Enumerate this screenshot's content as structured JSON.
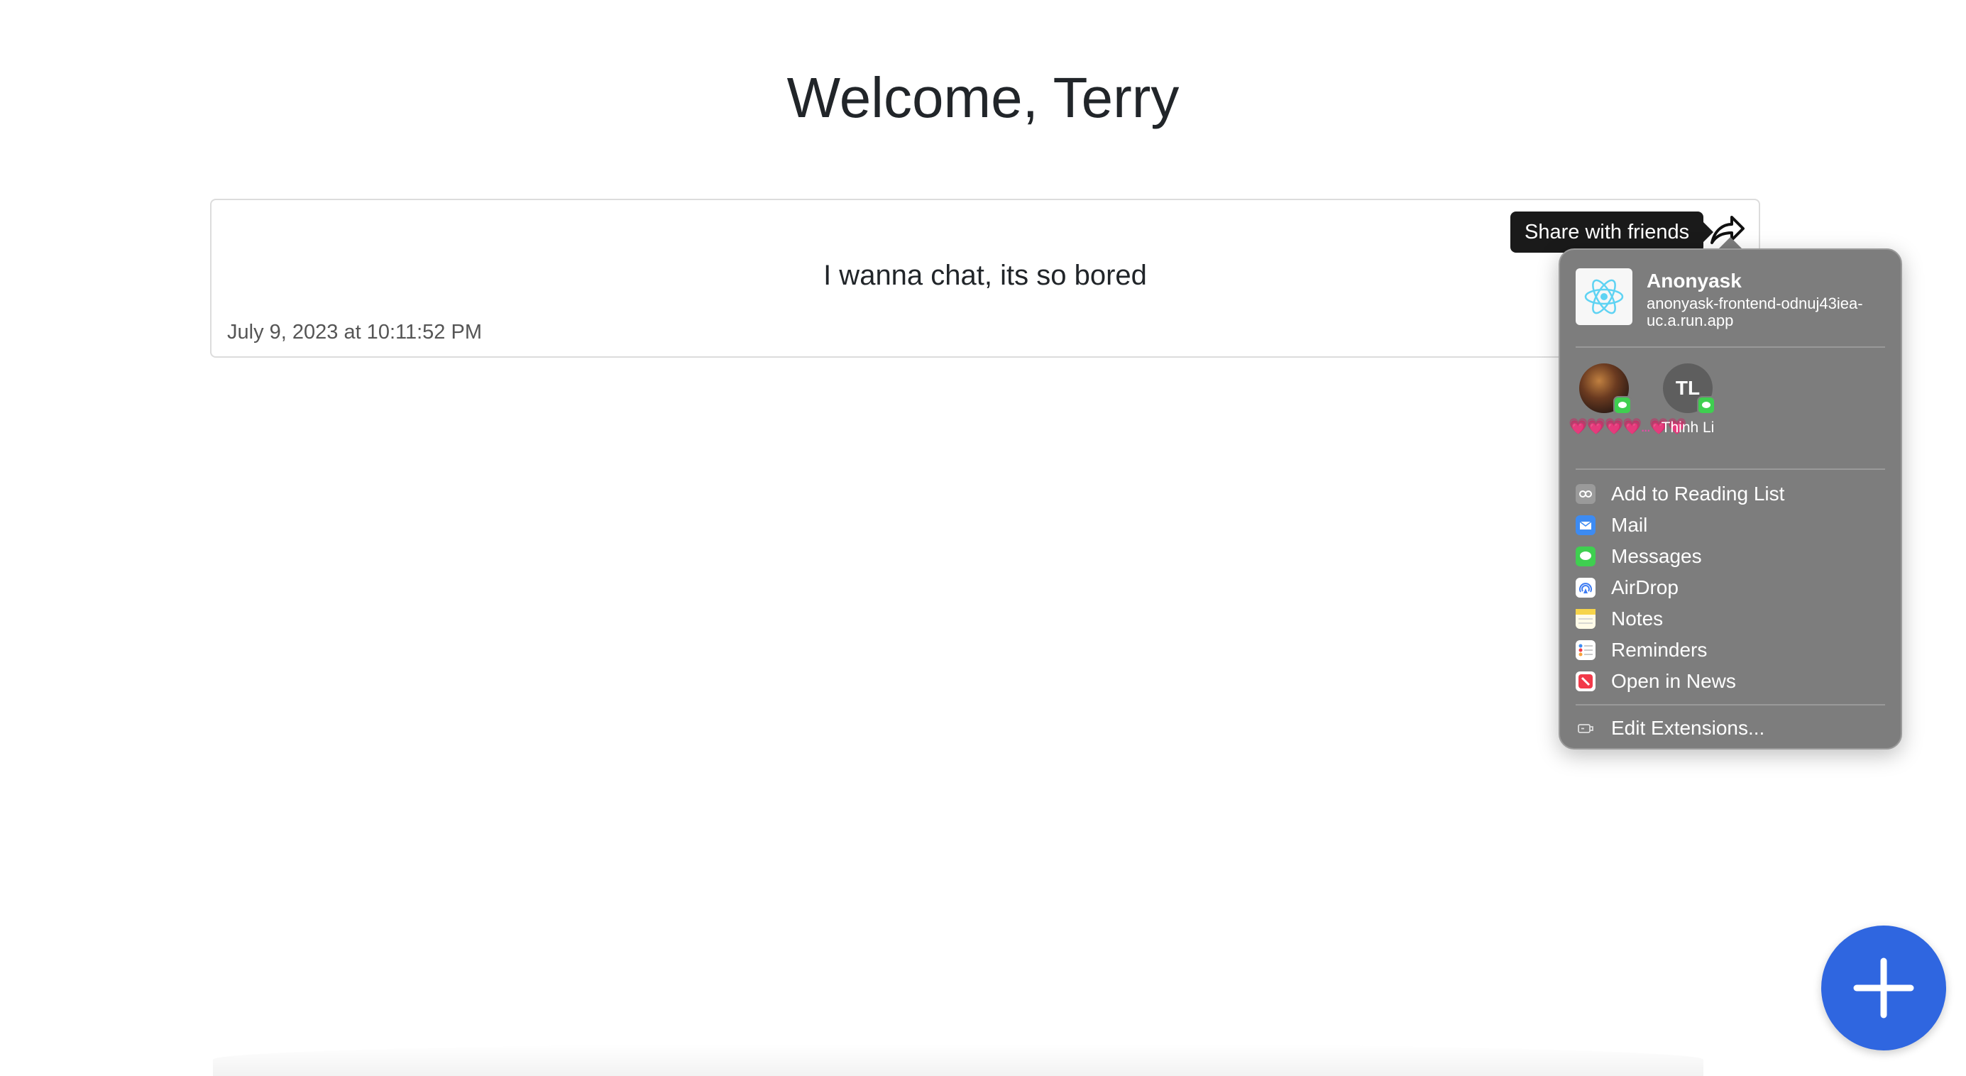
{
  "header": {
    "welcome_text": "Welcome, Terry"
  },
  "post": {
    "message": "I wanna chat, its so bored",
    "timestamp": "July 9, 2023 at 10:11:52 PM",
    "share_tooltip": "Share with friends",
    "share_icon": "share-arrow-icon"
  },
  "share_menu": {
    "app_name": "Anonyask",
    "app_url": "anonyask-frontend-odnuj43iea-uc.a.run.app",
    "app_icon": "react-logo-icon",
    "contacts": [
      {
        "name": "💗💗💗💗...💗💗",
        "avatar": "photo",
        "badge": "messages-badge-icon"
      },
      {
        "name": "Thinh Li",
        "initials": "TL",
        "badge": "messages-badge-icon"
      }
    ],
    "items": [
      {
        "label": "Add to Reading List",
        "icon": "reading-list-icon",
        "color": "#9a9a9a"
      },
      {
        "label": "Mail",
        "icon": "mail-icon",
        "color": "#3d8bf2"
      },
      {
        "label": "Messages",
        "icon": "messages-icon",
        "color": "#3fcf50"
      },
      {
        "label": "AirDrop",
        "icon": "airdrop-icon",
        "color": "#3d7bf2"
      },
      {
        "label": "Notes",
        "icon": "notes-icon",
        "color": "#f6d44a"
      },
      {
        "label": "Reminders",
        "icon": "reminders-icon",
        "color": "#ffffff"
      },
      {
        "label": "Open in News",
        "icon": "news-icon",
        "color": "#f23a4a"
      }
    ],
    "edit_extensions": {
      "label": "Edit Extensions...",
      "icon": "extensions-icon"
    }
  },
  "fab": {
    "icon": "plus-icon",
    "color": "#2f66e0"
  }
}
